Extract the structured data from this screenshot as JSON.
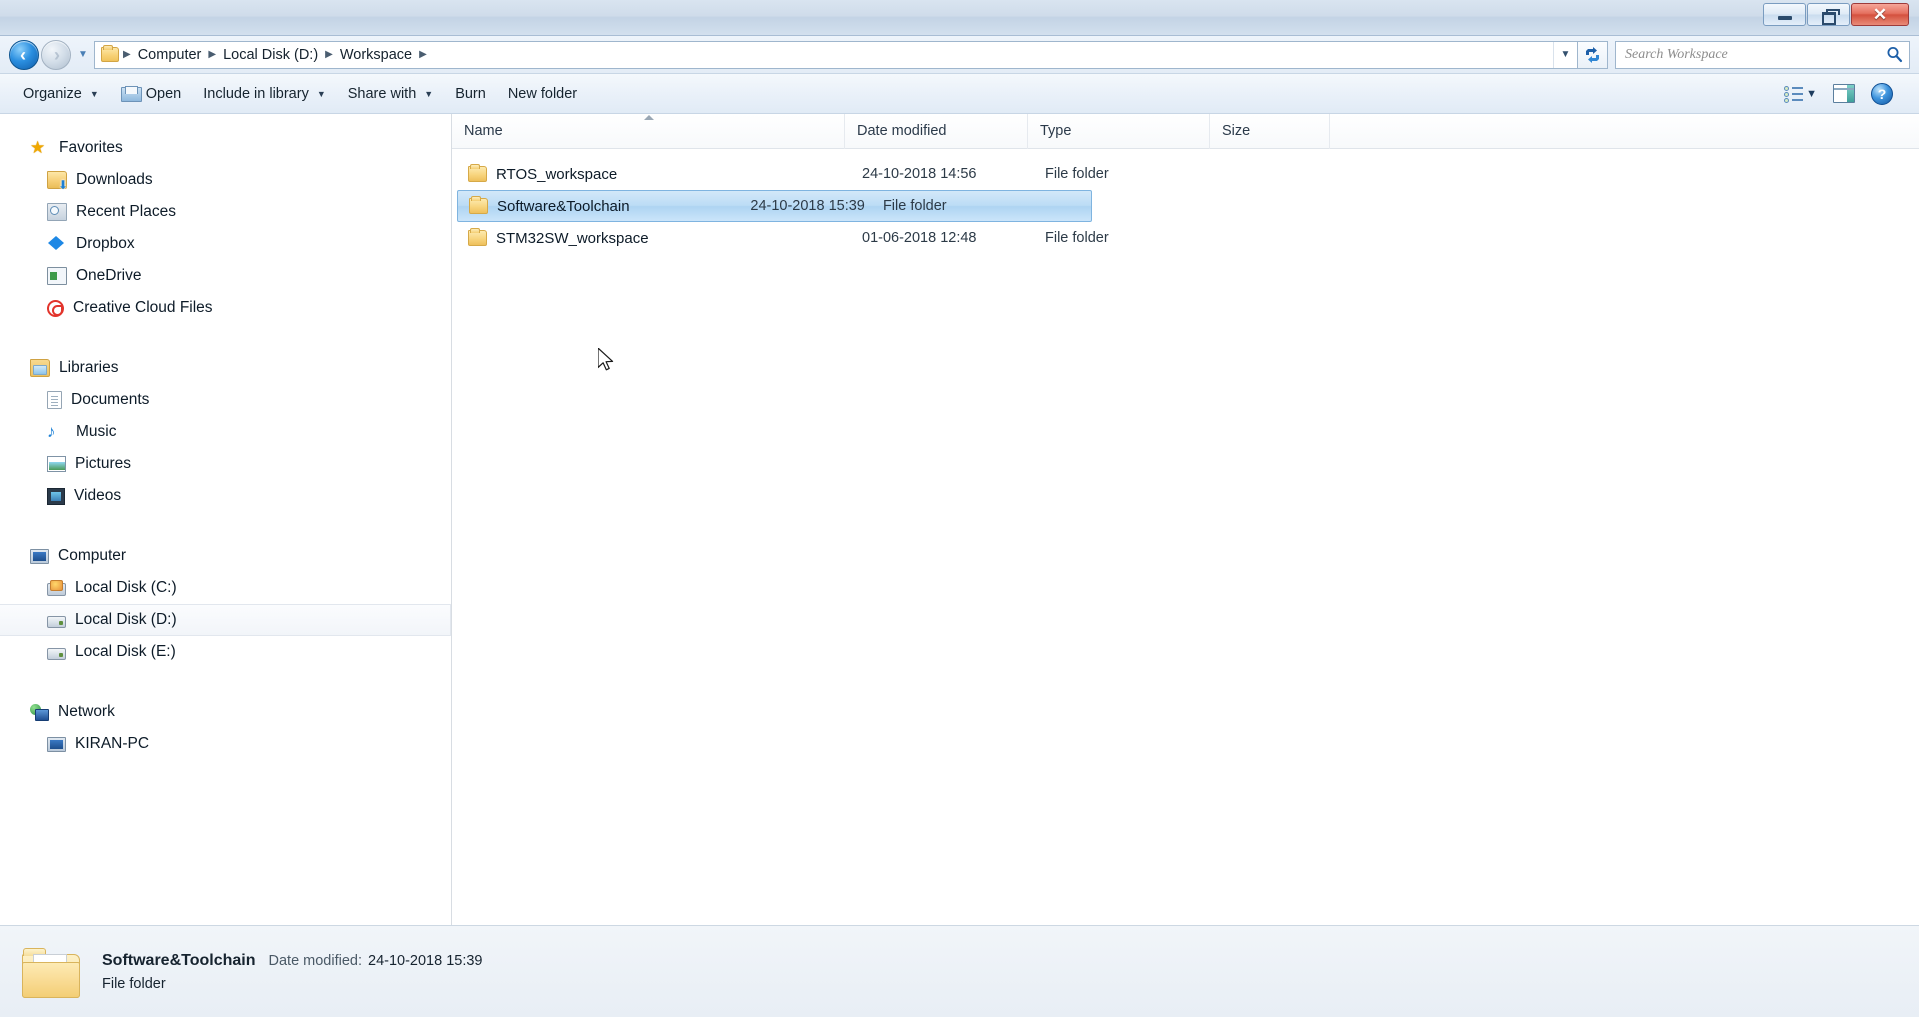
{
  "window": {
    "controls": {
      "minimize": "Minimize",
      "maximize": "Restore Down",
      "close": "Close",
      "close_glyph": "✕"
    }
  },
  "address_bar": {
    "back_label": "Back",
    "forward_label": "Forward",
    "recent_pages_label": "Recent Pages",
    "breadcrumbs": [
      "Computer",
      "Local Disk (D:)",
      "Workspace"
    ],
    "separator": "▶",
    "dropdown_label": "Previous Locations",
    "refresh_label": "Refresh"
  },
  "search": {
    "placeholder": "Search Workspace",
    "value": ""
  },
  "toolbar": {
    "items": [
      {
        "label": "Organize",
        "has_caret": true,
        "icon": null
      },
      {
        "label": "Open",
        "has_caret": false,
        "icon": "open-icon"
      },
      {
        "label": "Include in library",
        "has_caret": true,
        "icon": null
      },
      {
        "label": "Share with",
        "has_caret": true,
        "icon": null
      },
      {
        "label": "Burn",
        "has_caret": false,
        "icon": null
      },
      {
        "label": "New folder",
        "has_caret": false,
        "icon": null
      }
    ],
    "caret": "▼",
    "right_icons": [
      {
        "name": "view-options-icon",
        "caret": "▼"
      },
      {
        "name": "preview-pane-icon"
      },
      {
        "name": "help-icon",
        "glyph": "?"
      }
    ]
  },
  "sidebar": {
    "groups": [
      {
        "header": {
          "label": "Favorites",
          "icon": "star-icon"
        },
        "items": [
          {
            "label": "Downloads",
            "icon": "downloads-folder-icon"
          },
          {
            "label": "Recent Places",
            "icon": "recent-places-icon"
          },
          {
            "label": "Dropbox",
            "icon": "dropbox-icon"
          },
          {
            "label": "OneDrive",
            "icon": "onedrive-icon"
          },
          {
            "label": "Creative Cloud Files",
            "icon": "creative-cloud-icon"
          }
        ]
      },
      {
        "header": {
          "label": "Libraries",
          "icon": "libraries-icon"
        },
        "items": [
          {
            "label": "Documents",
            "icon": "documents-icon"
          },
          {
            "label": "Music",
            "icon": "music-icon"
          },
          {
            "label": "Pictures",
            "icon": "pictures-icon"
          },
          {
            "label": "Videos",
            "icon": "videos-icon"
          }
        ]
      },
      {
        "header": {
          "label": "Computer",
          "icon": "computer-icon"
        },
        "items": [
          {
            "label": "Local Disk (C:)",
            "icon": "system-disk-icon",
            "selected": false
          },
          {
            "label": "Local Disk (D:)",
            "icon": "disk-icon",
            "selected": true
          },
          {
            "label": "Local Disk (E:)",
            "icon": "disk-icon",
            "selected": false
          }
        ]
      },
      {
        "header": {
          "label": "Network",
          "icon": "network-icon"
        },
        "items": [
          {
            "label": "KIRAN-PC",
            "icon": "network-computer-icon"
          }
        ]
      }
    ]
  },
  "file_list": {
    "columns": [
      {
        "key": "name",
        "label": "Name",
        "sorted": true,
        "sort_direction": "ascending"
      },
      {
        "key": "date",
        "label": "Date modified",
        "sorted": false
      },
      {
        "key": "type",
        "label": "Type",
        "sorted": false
      },
      {
        "key": "size",
        "label": "Size",
        "sorted": false
      }
    ],
    "rows": [
      {
        "name": "RTOS_workspace",
        "date": "24-10-2018 14:56",
        "type": "File folder",
        "size": "",
        "selected": false
      },
      {
        "name": "Software&Toolchain",
        "date": "24-10-2018 15:39",
        "type": "File folder",
        "size": "",
        "selected": true
      },
      {
        "name": "STM32SW_workspace",
        "date": "01-06-2018 12:48",
        "type": "File folder",
        "size": "",
        "selected": false
      }
    ]
  },
  "details_pane": {
    "name": "Software&Toolchain",
    "date_label": "Date modified:",
    "date_value": "24-10-2018 15:39",
    "type": "File folder"
  },
  "colors": {
    "selection_blue": "#bcdcf5",
    "selection_border": "#7fb4e0",
    "folder_yellow": "#f8d57f",
    "titlebar_blue": "#cfdcea",
    "close_red": "#d4513e"
  }
}
